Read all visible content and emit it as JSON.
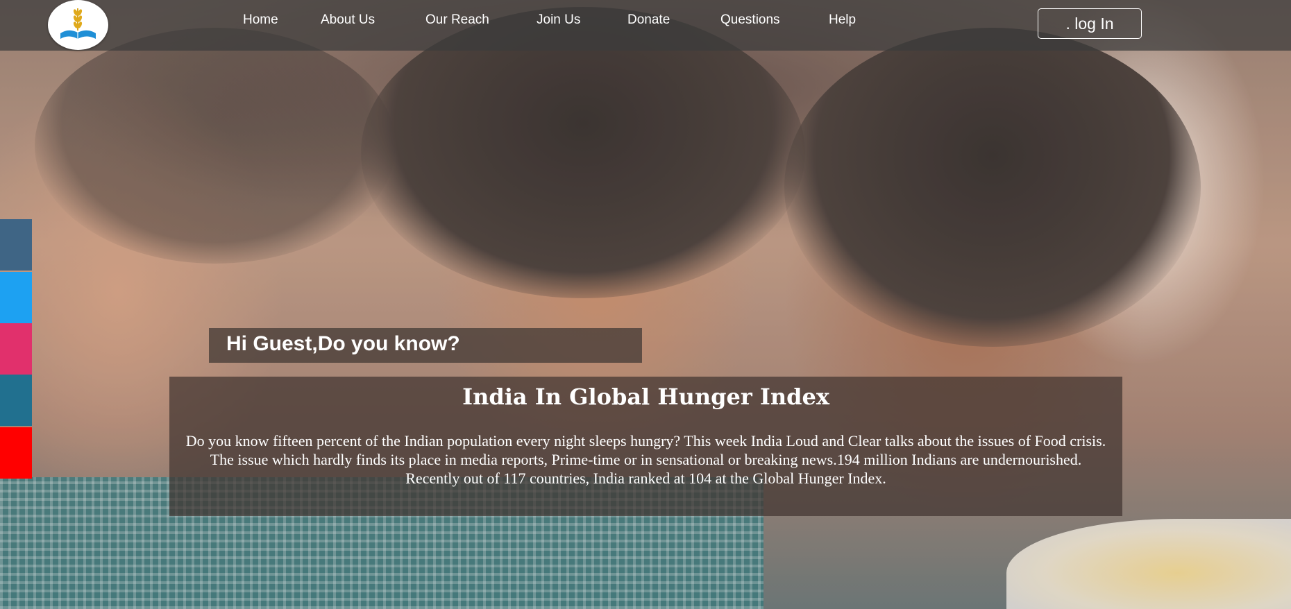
{
  "colors": {
    "navbar_bg": "rgba(60,60,60,0.72)",
    "panel_bg": "rgba(65,52,48,0.72)",
    "text": "#ffffff",
    "social_facebook": "#3f6585",
    "social_twitter": "#1da1f2",
    "social_instagram": "#e1306c",
    "social_linkedin": "#21708f",
    "social_youtube": "#ff0000"
  },
  "nav": {
    "logo_icon": "book-with-wheat-logo",
    "links": [
      "Home",
      "About Us",
      "Our Reach",
      "Join Us",
      "Donate",
      "Questions",
      "Help"
    ],
    "login_label": ". log In"
  },
  "social": [
    "facebook",
    "twitter",
    "instagram",
    "linkedin",
    "youtube"
  ],
  "hero": {
    "greeting": "Hi Guest,Do you know?",
    "title": "India In Global Hunger Index",
    "body": "Do you know fifteen percent of the Indian population every night sleeps hungry? This week India Loud and Clear talks about the issues of Food crisis. The issue which hardly finds its place in media reports, Prime-time or in sensational or breaking news.194 million Indians are undernourished. Recently out of 117 countries, India ranked at 104 at the Global Hunger Index."
  }
}
